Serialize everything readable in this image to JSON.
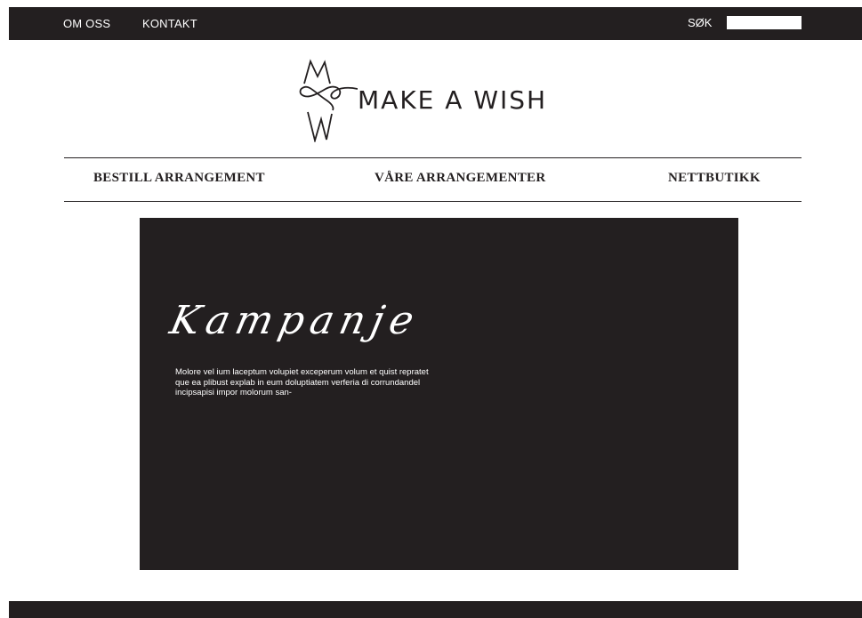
{
  "topbar": {
    "links": [
      "OM OSS",
      "KONTAKT"
    ],
    "search_label": "SØK",
    "search_value": ""
  },
  "logo": {
    "text": "MAKE A WISH",
    "icon": "mw-monogram-icon"
  },
  "main_nav": {
    "items": [
      "BESTILL ARRANGEMENT",
      "VÅRE ARRANGEMENTER",
      "NETTBUTIKK"
    ]
  },
  "hero": {
    "heading": "Kampanje",
    "body": "Molore vel ium laceptum volupiet exceperum volum et quist repratet que ea plibust explab in eum doluptiatem verferia di corrundandel incipsapisi impor molorum san-"
  },
  "colors": {
    "dark": "#231f20",
    "light": "#ffffff"
  }
}
